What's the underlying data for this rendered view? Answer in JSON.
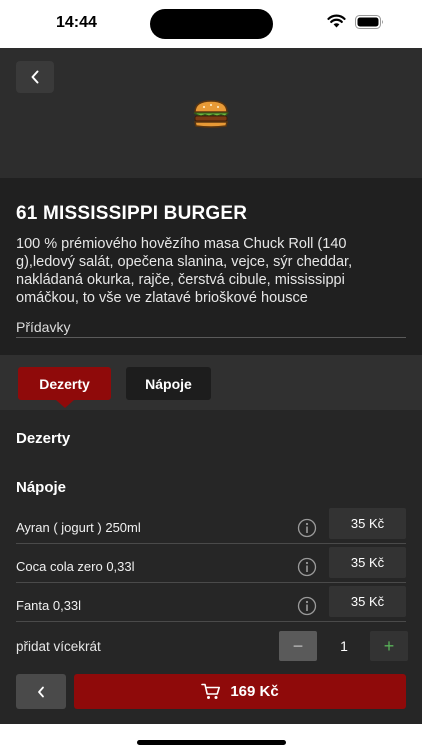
{
  "status_bar": {
    "time": "14:44"
  },
  "header": {
    "icon": "burger-icon"
  },
  "product": {
    "title": "61 MISSISSIPPI BURGER",
    "description": "100 % prémiového hovězího masa Chuck Roll (140 g),ledový salát, opečena slanina, vejce, sýr cheddar, nakládaná okurka, rajče, čerstvá cibule, mississippi omáčkou, to vše ve zlatavé brioškové housce",
    "extras_label": "Přídavky"
  },
  "tabs": [
    {
      "label": "Dezerty",
      "active": true
    },
    {
      "label": "Nápoje",
      "active": false
    }
  ],
  "sections": {
    "dezerty_title": "Dezerty",
    "napoje_title": "Nápoje"
  },
  "drinks": [
    {
      "name": "Ayran ( jogurt ) 250ml",
      "price": "35 Kč"
    },
    {
      "name": "Coca cola zero 0,33l",
      "price": "35 Kč"
    },
    {
      "name": "Fanta 0,33l",
      "price": "35 Kč"
    }
  ],
  "quantity": {
    "label": "přidat vícekrát",
    "minus": "−",
    "value": "1",
    "plus": "+"
  },
  "cart": {
    "total": "169 Kč"
  },
  "colors": {
    "accent": "#8f0a0a",
    "plus": "#58b058"
  }
}
